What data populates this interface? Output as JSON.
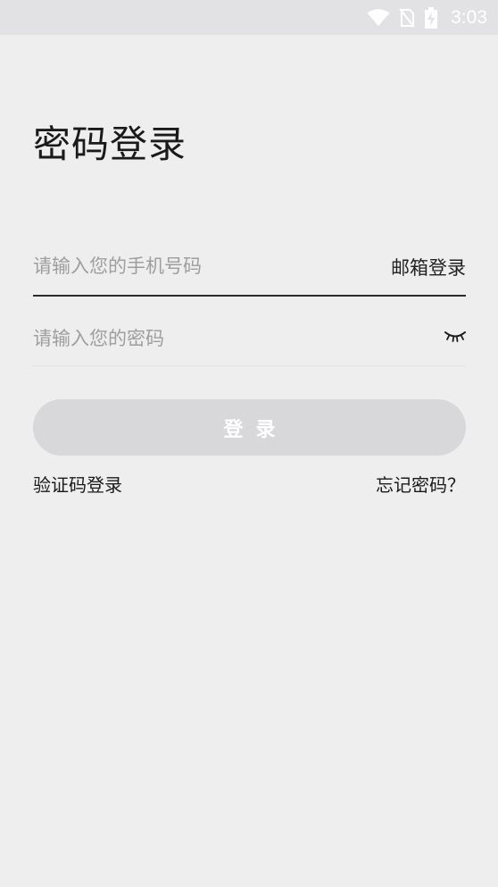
{
  "status_bar": {
    "time": "3:03",
    "icons": [
      "wifi-icon",
      "no-sim-icon",
      "battery-charging-icon"
    ]
  },
  "page": {
    "title": "密码登录"
  },
  "phone_field": {
    "placeholder": "请输入您的手机号码",
    "value": "",
    "email_login_label": "邮箱登录"
  },
  "password_field": {
    "placeholder": "请输入您的密码",
    "value": "",
    "visibility_icon": "eye-closed-icon"
  },
  "login_button": {
    "label": "登录"
  },
  "links": {
    "sms_login": "验证码登录",
    "forgot_password": "忘记密码？"
  },
  "colors": {
    "background": "#eeeeee",
    "status_bar": "#e2e2e4",
    "button_disabled": "#d8d8da",
    "text_primary": "#1a1a1a",
    "placeholder": "#9e9e9e"
  }
}
